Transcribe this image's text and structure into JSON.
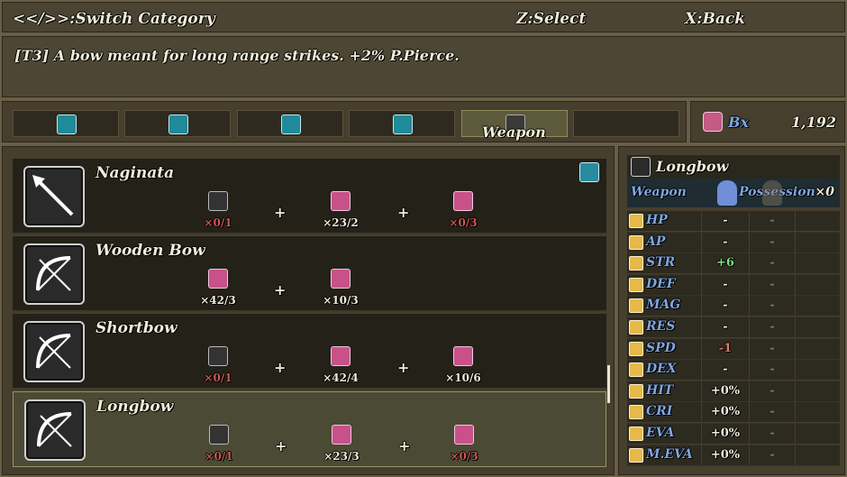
{
  "top_bar": {
    "switch": "<</>>:Switch Category",
    "select": "Z:Select",
    "back": "X:Back"
  },
  "description": "[T3] A bow meant for long range strikes. +2% P.Pierce.",
  "categories": [
    {
      "icon": "potion-icon",
      "active": false
    },
    {
      "icon": "potion-icon",
      "active": false
    },
    {
      "icon": "potion-icon",
      "active": false
    },
    {
      "icon": "potion-icon",
      "active": false
    },
    {
      "icon": "sword-icon",
      "active": true,
      "label": "Weapon"
    },
    {
      "icon": "",
      "active": false
    }
  ],
  "currency": {
    "name": "Bx",
    "amount": "1,192"
  },
  "recipes": [
    {
      "name": "Naginata",
      "icon": "spear-icon",
      "materials": [
        {
          "icon": "spear-icon",
          "count": "×0/1",
          "insufficient": true
        },
        {
          "icon": "bandage-material-icon",
          "count": "×23/2",
          "insufficient": false
        },
        {
          "icon": "ore-material-icon",
          "count": "×0/3",
          "insufficient": true
        }
      ],
      "craftable_icon": "hammer-icon"
    },
    {
      "name": "Wooden Bow",
      "icon": "bow-icon",
      "materials": [
        {
          "icon": "bandage-material-icon",
          "count": "×42/3",
          "insufficient": false
        },
        {
          "icon": "fiber-material-icon",
          "count": "×10/3",
          "insufficient": false
        }
      ]
    },
    {
      "name": "Shortbow",
      "icon": "bow-icon",
      "materials": [
        {
          "icon": "bow-icon",
          "count": "×0/1",
          "insufficient": true
        },
        {
          "icon": "bandage-material-icon",
          "count": "×42/4",
          "insufficient": false
        },
        {
          "icon": "fiber-material-icon",
          "count": "×10/6",
          "insufficient": false
        }
      ]
    },
    {
      "name": "Longbow",
      "icon": "bow-icon",
      "selected": true,
      "materials": [
        {
          "icon": "bow-icon",
          "count": "×0/1",
          "insufficient": true
        },
        {
          "icon": "bandage-material-icon",
          "count": "×23/3",
          "insufficient": false
        },
        {
          "icon": "ore-material-icon",
          "count": "×0/3",
          "insufficient": true
        }
      ]
    }
  ],
  "detail": {
    "item_name": "Longbow",
    "type": "Weapon",
    "possession_label": "Possession",
    "possession": "×0",
    "stats": [
      {
        "name": "HP",
        "value": "-",
        "other": "-"
      },
      {
        "name": "AP",
        "value": "-",
        "other": "-"
      },
      {
        "name": "STR",
        "value": "+6",
        "other": "-",
        "tone": "up"
      },
      {
        "name": "DEF",
        "value": "-",
        "other": "-"
      },
      {
        "name": "MAG",
        "value": "-",
        "other": "-"
      },
      {
        "name": "RES",
        "value": "-",
        "other": "-"
      },
      {
        "name": "SPD",
        "value": "-1",
        "other": "-",
        "tone": "down"
      },
      {
        "name": "DEX",
        "value": "-",
        "other": "-"
      },
      {
        "name": "HIT",
        "value": "+0%",
        "other": "-"
      },
      {
        "name": "CRI",
        "value": "+0%",
        "other": "-"
      },
      {
        "name": "EVA",
        "value": "+0%",
        "other": "-"
      },
      {
        "name": "M.EVA",
        "value": "+0%",
        "other": "-"
      }
    ]
  }
}
